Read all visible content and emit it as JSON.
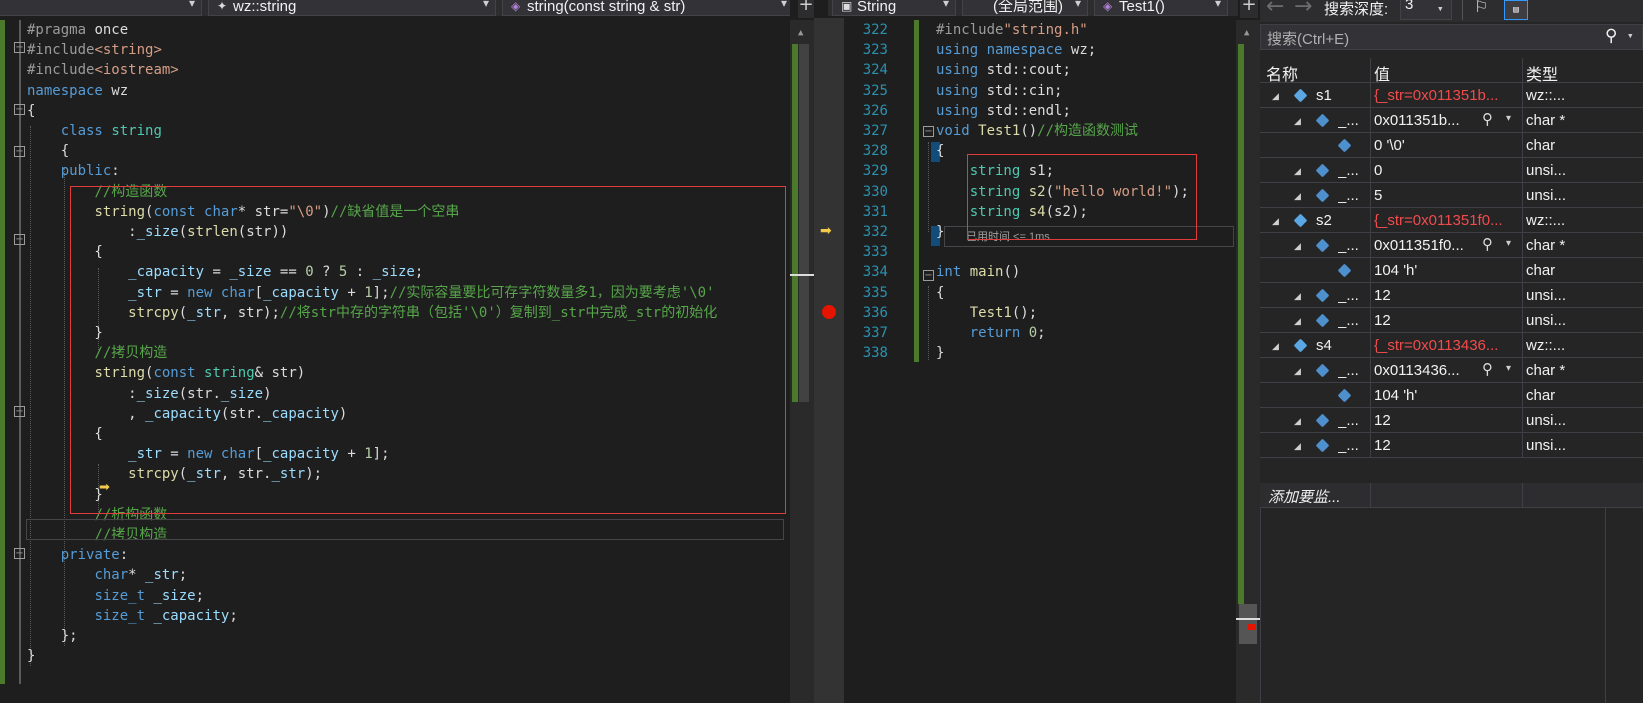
{
  "left_editor": {
    "dd1_label": "",
    "dd2_label": "wz::string",
    "dd3_label": "string(const string & str)",
    "lines": [
      "#pragma once",
      "#include<string>",
      "#include<iostream>",
      "namespace wz",
      "{",
      "    class string",
      "    {",
      "    public:",
      "        //构造函数",
      "        string(const char* str=\"\\0\")//缺省值是一个空串",
      "            :_size(strlen(str))",
      "        {",
      "            _capacity = _size == 0 ? 5 : _size;",
      "            _str = new char[_capacity + 1];//实际容量要比可存字符数量多1，因为要考虑'\\0'",
      "            strcpy(_str, str);//将str中存的字符串（包括'\\0'）复制到_str中完成_str的初始化",
      "        }",
      "        //拷贝构造",
      "        string(const string& str)",
      "            :_size(str._size)",
      "            , _capacity(str._capacity)",
      "        {",
      "            _str = new char[_capacity + 1];",
      "            strcpy(_str, str._str);",
      "        }",
      "        //析构函数",
      "        //拷贝构造",
      "    private:",
      "        char* _str;",
      "        size_t _size;",
      "        size_t _capacity;",
      "    };",
      "}"
    ]
  },
  "right_editor": {
    "dd1_label": "String",
    "dd2_label": "(全局范围)",
    "dd3_label": "Test1()",
    "line_numbers": [
      "322",
      "323",
      "324",
      "325",
      "326",
      "327",
      "328",
      "329",
      "330",
      "331",
      "332",
      "333",
      "334",
      "335",
      "336",
      "337",
      "338"
    ],
    "elapsed_label": "已用时间 <= 1ms"
  },
  "watch": {
    "search_depth_label": "搜索深度:",
    "search_depth_value": "3",
    "search_placeholder": "搜索(Ctrl+E)",
    "col_name": "名称",
    "col_value": "值",
    "col_type": "类型",
    "rows": [
      {
        "name": "s1",
        "value": "{_str=0x011351b...",
        "type": "wz::..."
      },
      {
        "name": "_...",
        "value": "0x011351b...",
        "type": "char *"
      },
      {
        "name": "",
        "value": "0 '\\0'",
        "type": "char"
      },
      {
        "name": "_...",
        "value": "0",
        "type": "unsi..."
      },
      {
        "name": "_...",
        "value": "5",
        "type": "unsi..."
      },
      {
        "name": "s2",
        "value": "{_str=0x011351f0...",
        "type": "wz::..."
      },
      {
        "name": "_...",
        "value": "0x011351f0...",
        "type": "char *"
      },
      {
        "name": "",
        "value": "104 'h'",
        "type": "char"
      },
      {
        "name": "_...",
        "value": "12",
        "type": "unsi..."
      },
      {
        "name": "_...",
        "value": "12",
        "type": "unsi..."
      },
      {
        "name": "s4",
        "value": "{_str=0x0113436...",
        "type": "wz::..."
      },
      {
        "name": "_...",
        "value": "0x0113436...",
        "type": "char *"
      },
      {
        "name": "",
        "value": "104 'h'",
        "type": "char"
      },
      {
        "name": "_...",
        "value": "12",
        "type": "unsi..."
      },
      {
        "name": "_...",
        "value": "12",
        "type": "unsi..."
      }
    ],
    "add_watch_label": "添加要监..."
  }
}
